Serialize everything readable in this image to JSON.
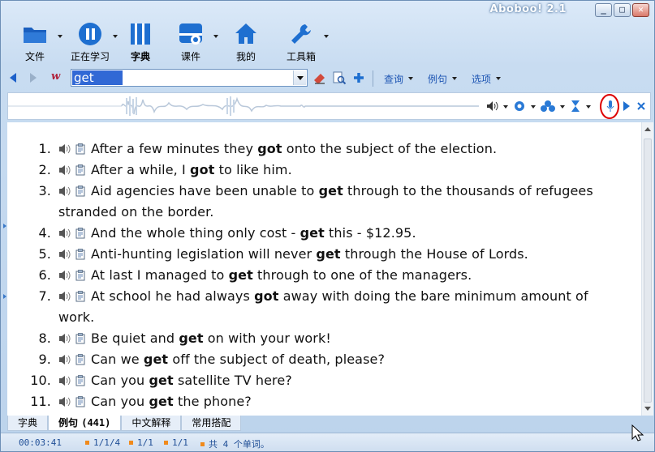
{
  "window": {
    "title": "Aboboo! 2.1",
    "buttons": {
      "minimize": "_",
      "maximize": "□",
      "close": "✕"
    }
  },
  "toolbar": [
    {
      "label": "文件",
      "icon": "folder-icon",
      "has_menu": true
    },
    {
      "label": "正在学习",
      "icon": "pause-icon",
      "has_menu": true
    },
    {
      "label": "字典",
      "icon": "book-icon",
      "has_menu": false
    },
    {
      "label": "课件",
      "icon": "disc-icon",
      "has_menu": true
    },
    {
      "label": "我的",
      "icon": "home-icon",
      "has_menu": false
    },
    {
      "label": "工具箱",
      "icon": "wrench-icon",
      "has_menu": true
    }
  ],
  "search": {
    "value": "get",
    "menus": [
      "查询",
      "例句",
      "选项"
    ]
  },
  "examples": [
    {
      "num": "1.",
      "parts": [
        "After a few minutes they ",
        "got",
        " onto the subject of the election."
      ]
    },
    {
      "num": "2.",
      "parts": [
        "After a while, I ",
        "got",
        " to like him."
      ]
    },
    {
      "num": "3.",
      "parts": [
        "Aid agencies have been unable to ",
        "get",
        " through to the thousands of refugees stranded on the border."
      ]
    },
    {
      "num": "4.",
      "parts": [
        "And the whole thing only cost - ",
        "get",
        " this - $12.95."
      ]
    },
    {
      "num": "5.",
      "parts": [
        "Anti-hunting legislation will never ",
        "get",
        " through the House of Lords."
      ]
    },
    {
      "num": "6.",
      "parts": [
        "At last I managed to ",
        "get",
        " through to one of the managers."
      ]
    },
    {
      "num": "7.",
      "parts": [
        "At school he had always ",
        "got",
        " away with doing the bare minimum amount of work."
      ]
    },
    {
      "num": "8.",
      "parts": [
        "Be quiet and ",
        "get",
        " on with your work!"
      ]
    },
    {
      "num": "9.",
      "parts": [
        "Can we ",
        "get",
        " off the subject of death, please?"
      ]
    },
    {
      "num": "10.",
      "parts": [
        "Can you ",
        "get",
        " satellite TV here?"
      ]
    },
    {
      "num": "11.",
      "parts": [
        "Can you ",
        "get",
        " the phone?"
      ]
    }
  ],
  "tabs": [
    {
      "label": "字典",
      "count": "",
      "active": false
    },
    {
      "label": "例句",
      "count": "(441)",
      "active": true
    },
    {
      "label": "中文解释",
      "count": "",
      "active": false
    },
    {
      "label": "常用搭配",
      "count": "",
      "active": false
    }
  ],
  "status": {
    "time": "00:03:41",
    "field1": "1/1/4",
    "field2": "1/1",
    "field3": "1/1",
    "words": "共 4 个单词。"
  },
  "colors": {
    "accent": "#1d60c9",
    "selection": "#3168d5",
    "status_dot": "#f08a1c",
    "highlight_ring": "#dd0000"
  }
}
